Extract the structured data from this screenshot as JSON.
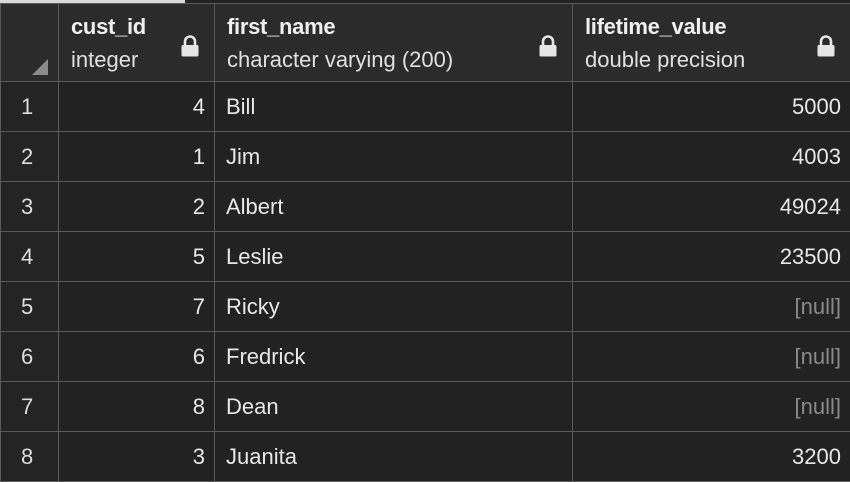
{
  "columns": [
    {
      "name": "cust_id",
      "type": "integer",
      "icon": "lock-icon"
    },
    {
      "name": "first_name",
      "type": "character varying (200)",
      "icon": "lock-icon"
    },
    {
      "name": "lifetime_value",
      "type": "double precision",
      "icon": "lock-icon"
    }
  ],
  "rows": [
    {
      "row": "1",
      "cust_id": "4",
      "first_name": "Bill",
      "lifetime_value": "5000"
    },
    {
      "row": "2",
      "cust_id": "1",
      "first_name": "Jim",
      "lifetime_value": "4003"
    },
    {
      "row": "3",
      "cust_id": "2",
      "first_name": "Albert",
      "lifetime_value": "49024"
    },
    {
      "row": "4",
      "cust_id": "5",
      "first_name": "Leslie",
      "lifetime_value": "23500"
    },
    {
      "row": "5",
      "cust_id": "7",
      "first_name": "Ricky",
      "lifetime_value": "[null]"
    },
    {
      "row": "6",
      "cust_id": "6",
      "first_name": "Fredrick",
      "lifetime_value": "[null]"
    },
    {
      "row": "7",
      "cust_id": "8",
      "first_name": "Dean",
      "lifetime_value": "[null]"
    },
    {
      "row": "8",
      "cust_id": "3",
      "first_name": "Juanita",
      "lifetime_value": "3200"
    }
  ],
  "null_text": "[null]",
  "colors": {
    "background": "#222222",
    "header_background": "#2b2b2b",
    "gridline": "#5a5a5a",
    "text": "#e8e8e8",
    "null_text": "#8a8a8a"
  }
}
